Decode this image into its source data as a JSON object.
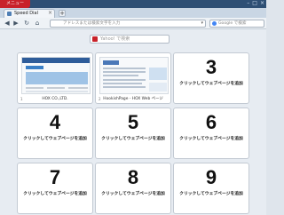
{
  "app": {
    "menu_label": "メニュー",
    "window_controls": [
      "–",
      "□",
      "×"
    ]
  },
  "tabs": [
    {
      "label": "Speed Dial",
      "close_glyph": "×"
    }
  ],
  "new_tab_glyph": "+",
  "toolbar": {
    "back": "◀",
    "forward": "▶",
    "reload": "↻",
    "home": "⌂",
    "address_placeholder": "アドレスまたは検索文字を入力",
    "search_placeholder": "Google で検索"
  },
  "speed_dial": {
    "search_placeholder": "Yahoo! で検索",
    "hint": "クリックしてウェブページを追加",
    "tiles": [
      {
        "index": "1",
        "caption": "HOX CO.,LTD."
      },
      {
        "index": "2",
        "caption": "HookishPage - HOX Web ページ"
      },
      {
        "number": "3"
      },
      {
        "number": "4"
      },
      {
        "number": "5"
      },
      {
        "number": "6"
      },
      {
        "number": "7"
      },
      {
        "number": "8"
      },
      {
        "number": "9"
      }
    ]
  },
  "colors": {
    "opera_red": "#c8222a",
    "title_bar": "#2e4f74",
    "content_bg": "#e7ecf2"
  }
}
